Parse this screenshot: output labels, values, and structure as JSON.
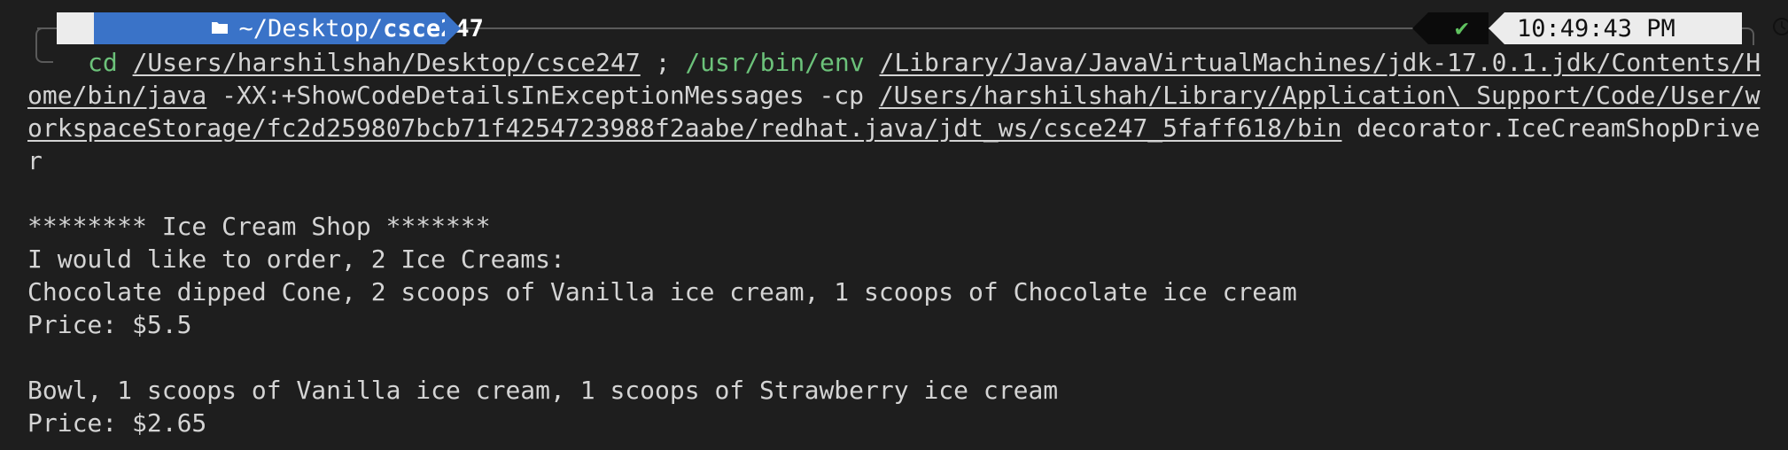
{
  "prompt": {
    "os_icon": "apple-icon",
    "dir_icon": "folder-icon",
    "dir_prefix": "~/Desktop/",
    "dir_name": "csce247",
    "status_icon": "✔",
    "time": "10:49:43 PM",
    "time_icon": "clock-icon",
    "colors": {
      "os_segment": "#ececec",
      "dir_segment": "#3a73c8",
      "status_ok": "#5fc25f",
      "command": "#6cc27a"
    }
  },
  "command": {
    "line1": {
      "cd": "cd",
      "sp1": " ",
      "path1": "/Users/harshilshah/Desktop/csce247",
      "sep": " ; ",
      "env": "/usr/bin/env",
      "sp2": " ",
      "java_path_a": "/Library/Java/JavaVirtualMachines/jdk-17.0.1.jdk/Contents/H"
    },
    "line2": {
      "java_path_b": "ome/bin/java",
      "flags": " -XX:+ShowCodeDetailsInExceptionMessages -cp ",
      "cp_a": "/Users/harshilshah/Library/Application\\ Support/Code/User/w"
    },
    "line3": {
      "cp_b": "orkspaceStorage/fc2d259807bcb71f4254723988f2aabe/redhat.java/jdt_ws/csce247_5faff618/bin",
      "main_a": " decorator.IceCreamShopDrive"
    },
    "line4": {
      "main_b": "r"
    }
  },
  "output": {
    "header": "******** Ice Cream Shop *******",
    "intro": "I would like to order, 2 Ice Creams:",
    "order1": "Chocolate dipped Cone, 2 scoops of Vanilla ice cream, 1 scoops of Chocolate ice cream",
    "price1": "Price: $5.5",
    "order2": "Bowl, 1 scoops of Vanilla ice cream, 1 scoops of Strawberry ice cream",
    "price2": "Price: $2.65"
  }
}
